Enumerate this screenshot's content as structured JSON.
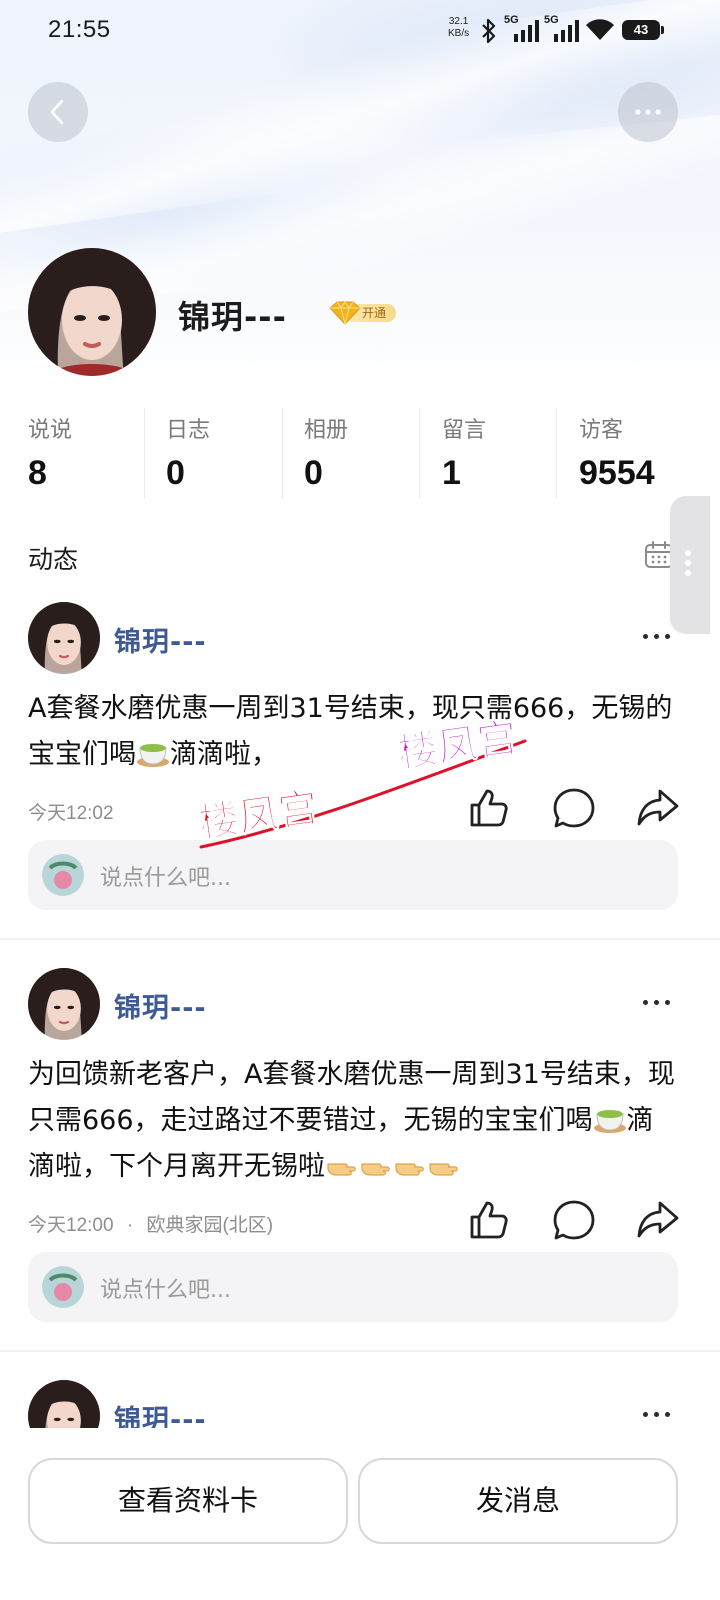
{
  "status_bar": {
    "time": "21:55",
    "net_speed_value": "32.1",
    "net_speed_unit": "KB/s",
    "signal1_label": "5G",
    "signal2_label": "5G",
    "battery": "43"
  },
  "profile": {
    "name": "锦玥---",
    "vip_label": "开通"
  },
  "stats": [
    {
      "label": "说说",
      "value": "8"
    },
    {
      "label": "日志",
      "value": "0"
    },
    {
      "label": "相册",
      "value": "0"
    },
    {
      "label": "留言",
      "value": "1"
    },
    {
      "label": "访客",
      "value": "9554"
    }
  ],
  "feed": {
    "title": "动态",
    "posts": [
      {
        "author": "锦玥---",
        "text_before_emoji": "A套餐水磨优惠一周到31号结束，现只需666，无锡的宝宝们喝",
        "text_after_emoji": "滴滴啦，",
        "text_tail": "",
        "time": "今天12:02",
        "location": "",
        "comment_placeholder": "说点什么吧..."
      },
      {
        "author": "锦玥---",
        "text_before_emoji": "为回馈新老客户，A套餐水磨优惠一周到31号结束，现只需666，走过路过不要错过，无锡的宝宝们喝",
        "text_after_emoji": "滴滴啦，下个月离开无锡啦",
        "text_tail": "",
        "time": "今天12:00",
        "location": "欧典家园(北区)",
        "comment_placeholder": "说点什么吧..."
      },
      {
        "author": "锦玥---"
      }
    ]
  },
  "watermark": {
    "text1": "楼凤宫",
    "text2": "楼凤宫"
  },
  "bottom_bar": {
    "profile_card_label": "查看资料卡",
    "message_label": "发消息"
  },
  "colors": {
    "author_name": "#3d5a94",
    "watermark_red": "#e0102a",
    "watermark_purple": "#c21cd6"
  }
}
